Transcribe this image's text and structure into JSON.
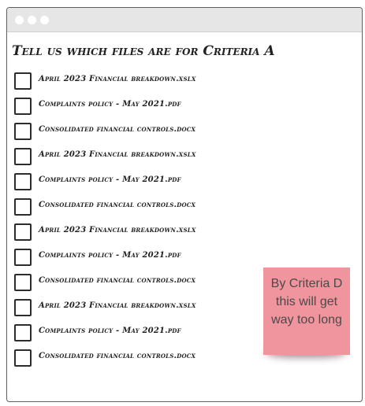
{
  "heading": "Tell us which files are for Criteria A",
  "files": [
    {
      "label": "April 2023 Financial breakdown.xslx",
      "checked": false
    },
    {
      "label": "Complaints policy - May 2021.pdf",
      "checked": false
    },
    {
      "label": "Consolidated financial controls.docx",
      "checked": false
    },
    {
      "label": "April 2023 Financial breakdown.xslx",
      "checked": false
    },
    {
      "label": "Complaints policy - May 2021.pdf",
      "checked": false
    },
    {
      "label": "Consolidated financial controls.docx",
      "checked": false
    },
    {
      "label": "April 2023 Financial breakdown.xslx",
      "checked": false
    },
    {
      "label": "Complaints policy - May 2021.pdf",
      "checked": false
    },
    {
      "label": "Consolidated financial controls.docx",
      "checked": false
    },
    {
      "label": "April 2023 Financial breakdown.xslx",
      "checked": false
    },
    {
      "label": "Complaints policy - May 2021.pdf",
      "checked": false
    },
    {
      "label": "Consolidated financial controls.docx",
      "checked": false
    }
  ],
  "sticky_note": "By Criteria D this will get way too long",
  "colors": {
    "titlebar": "#e6e6e6",
    "sticky": "#f0959e",
    "text": "#222222"
  }
}
